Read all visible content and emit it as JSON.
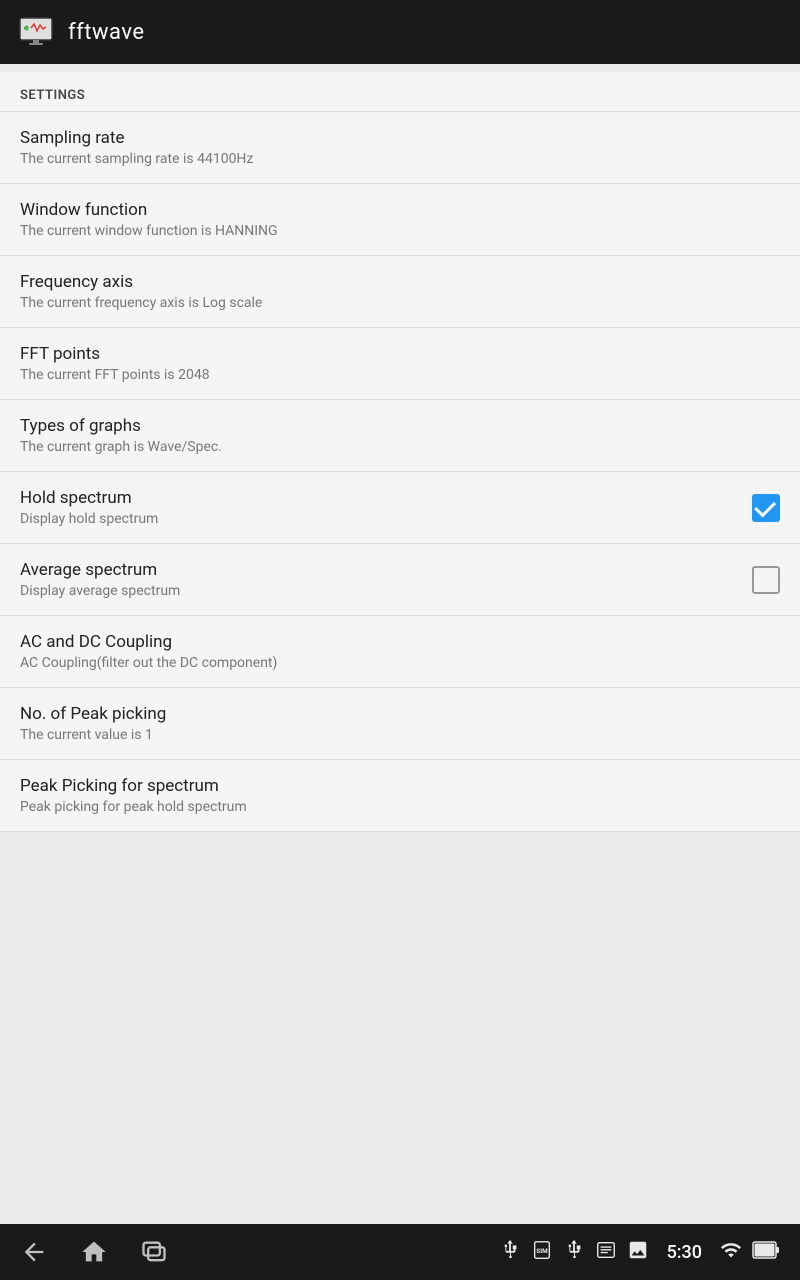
{
  "app": {
    "title": "fftwave"
  },
  "settings": {
    "header": "SETTINGS",
    "items": [
      {
        "id": "sampling-rate",
        "title": "Sampling rate",
        "subtitle": "The current sampling rate is 44100Hz",
        "control": "none"
      },
      {
        "id": "window-function",
        "title": "Window function",
        "subtitle": "The current window function is HANNING",
        "control": "none"
      },
      {
        "id": "frequency-axis",
        "title": "Frequency axis",
        "subtitle": "The current frequency axis is Log scale",
        "control": "none"
      },
      {
        "id": "fft-points",
        "title": "FFT points",
        "subtitle": "The current FFT points is 2048",
        "control": "none"
      },
      {
        "id": "types-of-graphs",
        "title": "Types of graphs",
        "subtitle": "The current graph is Wave/Spec.",
        "control": "none"
      },
      {
        "id": "hold-spectrum",
        "title": "Hold spectrum",
        "subtitle": "Display hold spectrum",
        "control": "checkbox-checked"
      },
      {
        "id": "average-spectrum",
        "title": "Average spectrum",
        "subtitle": "Display average spectrum",
        "control": "checkbox-unchecked"
      },
      {
        "id": "ac-dc-coupling",
        "title": "AC and DC Coupling",
        "subtitle": "AC Coupling(filter out the DC component)",
        "control": "none"
      },
      {
        "id": "no-peak-picking",
        "title": "No. of Peak picking",
        "subtitle": "The current value is 1",
        "control": "none"
      },
      {
        "id": "peak-picking-spectrum",
        "title": "Peak Picking for spectrum",
        "subtitle": "Peak picking for peak hold spectrum",
        "control": "none"
      }
    ]
  },
  "nav": {
    "time": "5:30"
  }
}
